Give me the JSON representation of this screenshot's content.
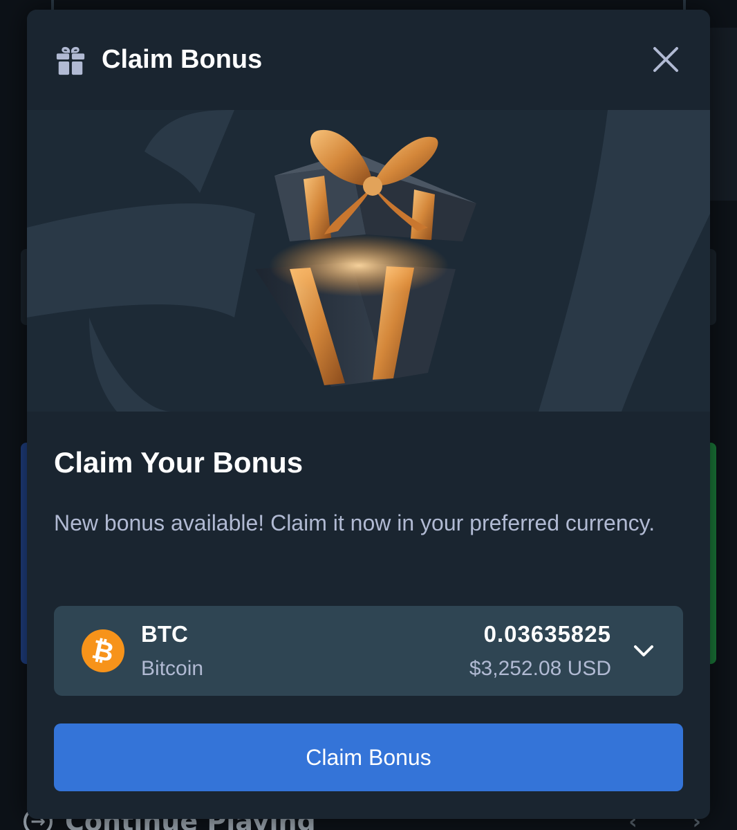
{
  "modal": {
    "title": "Claim Bonus",
    "heading": "Claim Your Bonus",
    "description": "New bonus available! Claim it now in your preferred currency.",
    "claim_button_label": "Claim Bonus"
  },
  "currency": {
    "code": "BTC",
    "name": "Bitcoin",
    "amount": "0.03635825",
    "usd_value": "$3,252.08 USD",
    "icon": "bitcoin-icon",
    "icon_glyph": "₿",
    "icon_color": "#f7931a"
  },
  "background": {
    "continue_label": "Continue Playing"
  },
  "colors": {
    "modal_bg": "#1a2530",
    "select_bg": "#2f4553",
    "button_bg": "#3474d8",
    "muted_text": "#b1bad3",
    "gift_ribbon": "#e7a24a"
  }
}
